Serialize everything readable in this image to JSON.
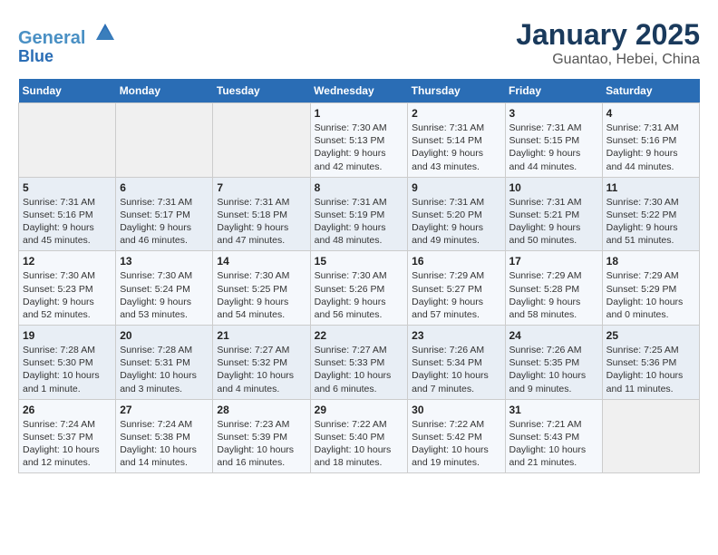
{
  "header": {
    "logo_line1": "General",
    "logo_line2": "Blue",
    "title": "January 2025",
    "subtitle": "Guantao, Hebei, China"
  },
  "weekdays": [
    "Sunday",
    "Monday",
    "Tuesday",
    "Wednesday",
    "Thursday",
    "Friday",
    "Saturday"
  ],
  "weeks": [
    [
      {
        "num": "",
        "info": ""
      },
      {
        "num": "",
        "info": ""
      },
      {
        "num": "",
        "info": ""
      },
      {
        "num": "1",
        "info": "Sunrise: 7:30 AM\nSunset: 5:13 PM\nDaylight: 9 hours and 42 minutes."
      },
      {
        "num": "2",
        "info": "Sunrise: 7:31 AM\nSunset: 5:14 PM\nDaylight: 9 hours and 43 minutes."
      },
      {
        "num": "3",
        "info": "Sunrise: 7:31 AM\nSunset: 5:15 PM\nDaylight: 9 hours and 44 minutes."
      },
      {
        "num": "4",
        "info": "Sunrise: 7:31 AM\nSunset: 5:16 PM\nDaylight: 9 hours and 44 minutes."
      }
    ],
    [
      {
        "num": "5",
        "info": "Sunrise: 7:31 AM\nSunset: 5:16 PM\nDaylight: 9 hours and 45 minutes."
      },
      {
        "num": "6",
        "info": "Sunrise: 7:31 AM\nSunset: 5:17 PM\nDaylight: 9 hours and 46 minutes."
      },
      {
        "num": "7",
        "info": "Sunrise: 7:31 AM\nSunset: 5:18 PM\nDaylight: 9 hours and 47 minutes."
      },
      {
        "num": "8",
        "info": "Sunrise: 7:31 AM\nSunset: 5:19 PM\nDaylight: 9 hours and 48 minutes."
      },
      {
        "num": "9",
        "info": "Sunrise: 7:31 AM\nSunset: 5:20 PM\nDaylight: 9 hours and 49 minutes."
      },
      {
        "num": "10",
        "info": "Sunrise: 7:31 AM\nSunset: 5:21 PM\nDaylight: 9 hours and 50 minutes."
      },
      {
        "num": "11",
        "info": "Sunrise: 7:30 AM\nSunset: 5:22 PM\nDaylight: 9 hours and 51 minutes."
      }
    ],
    [
      {
        "num": "12",
        "info": "Sunrise: 7:30 AM\nSunset: 5:23 PM\nDaylight: 9 hours and 52 minutes."
      },
      {
        "num": "13",
        "info": "Sunrise: 7:30 AM\nSunset: 5:24 PM\nDaylight: 9 hours and 53 minutes."
      },
      {
        "num": "14",
        "info": "Sunrise: 7:30 AM\nSunset: 5:25 PM\nDaylight: 9 hours and 54 minutes."
      },
      {
        "num": "15",
        "info": "Sunrise: 7:30 AM\nSunset: 5:26 PM\nDaylight: 9 hours and 56 minutes."
      },
      {
        "num": "16",
        "info": "Sunrise: 7:29 AM\nSunset: 5:27 PM\nDaylight: 9 hours and 57 minutes."
      },
      {
        "num": "17",
        "info": "Sunrise: 7:29 AM\nSunset: 5:28 PM\nDaylight: 9 hours and 58 minutes."
      },
      {
        "num": "18",
        "info": "Sunrise: 7:29 AM\nSunset: 5:29 PM\nDaylight: 10 hours and 0 minutes."
      }
    ],
    [
      {
        "num": "19",
        "info": "Sunrise: 7:28 AM\nSunset: 5:30 PM\nDaylight: 10 hours and 1 minute."
      },
      {
        "num": "20",
        "info": "Sunrise: 7:28 AM\nSunset: 5:31 PM\nDaylight: 10 hours and 3 minutes."
      },
      {
        "num": "21",
        "info": "Sunrise: 7:27 AM\nSunset: 5:32 PM\nDaylight: 10 hours and 4 minutes."
      },
      {
        "num": "22",
        "info": "Sunrise: 7:27 AM\nSunset: 5:33 PM\nDaylight: 10 hours and 6 minutes."
      },
      {
        "num": "23",
        "info": "Sunrise: 7:26 AM\nSunset: 5:34 PM\nDaylight: 10 hours and 7 minutes."
      },
      {
        "num": "24",
        "info": "Sunrise: 7:26 AM\nSunset: 5:35 PM\nDaylight: 10 hours and 9 minutes."
      },
      {
        "num": "25",
        "info": "Sunrise: 7:25 AM\nSunset: 5:36 PM\nDaylight: 10 hours and 11 minutes."
      }
    ],
    [
      {
        "num": "26",
        "info": "Sunrise: 7:24 AM\nSunset: 5:37 PM\nDaylight: 10 hours and 12 minutes."
      },
      {
        "num": "27",
        "info": "Sunrise: 7:24 AM\nSunset: 5:38 PM\nDaylight: 10 hours and 14 minutes."
      },
      {
        "num": "28",
        "info": "Sunrise: 7:23 AM\nSunset: 5:39 PM\nDaylight: 10 hours and 16 minutes."
      },
      {
        "num": "29",
        "info": "Sunrise: 7:22 AM\nSunset: 5:40 PM\nDaylight: 10 hours and 18 minutes."
      },
      {
        "num": "30",
        "info": "Sunrise: 7:22 AM\nSunset: 5:42 PM\nDaylight: 10 hours and 19 minutes."
      },
      {
        "num": "31",
        "info": "Sunrise: 7:21 AM\nSunset: 5:43 PM\nDaylight: 10 hours and 21 minutes."
      },
      {
        "num": "",
        "info": ""
      }
    ]
  ]
}
